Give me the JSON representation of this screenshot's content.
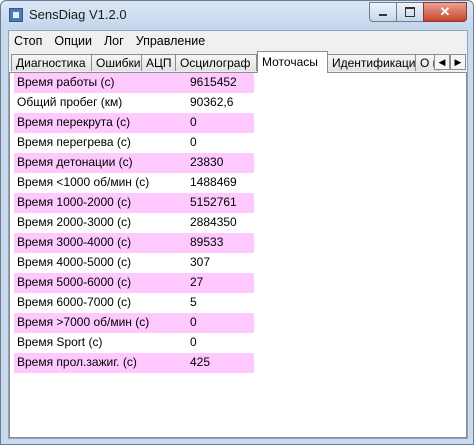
{
  "window": {
    "title": "SensDiag V1.2.0"
  },
  "menu": [
    "Стоп",
    "Опции",
    "Лог",
    "Управление"
  ],
  "tabs": {
    "items": [
      "Диагностика",
      "Ошибки",
      "АЦП",
      "Осцилограф",
      "Моточасы",
      "Идентификация",
      "О п"
    ],
    "active": "Моточасы",
    "scroll_left": "◀",
    "scroll_right": "▶"
  },
  "rows": [
    {
      "label": "Время работы (с)",
      "value": "9615452"
    },
    {
      "label": "Общий пробег (км)",
      "value": "90362,6"
    },
    {
      "label": "Время перекрута (с)",
      "value": "0"
    },
    {
      "label": "Время перегрева (с)",
      "value": "0"
    },
    {
      "label": "Время детонации (с)",
      "value": "23830"
    },
    {
      "label": "Время <1000 об/мин (с)",
      "value": "1488469"
    },
    {
      "label": "Время 1000-2000 (с)",
      "value": "5152761"
    },
    {
      "label": "Время 2000-3000 (с)",
      "value": "2884350"
    },
    {
      "label": "Время 3000-4000 (с)",
      "value": "89533"
    },
    {
      "label": "Время 4000-5000 (с)",
      "value": "307"
    },
    {
      "label": "Время 5000-6000 (с)",
      "value": "27"
    },
    {
      "label": "Время 6000-7000 (с)",
      "value": "5"
    },
    {
      "label": "Время >7000 об/мин (с)",
      "value": "0"
    },
    {
      "label": "Время Sport (с)",
      "value": "0"
    },
    {
      "label": "Время прол.зажиг. (с)",
      "value": "425"
    }
  ],
  "colors": {
    "row_highlight": "#ffc8ff",
    "titlebar": "#c9daee"
  }
}
